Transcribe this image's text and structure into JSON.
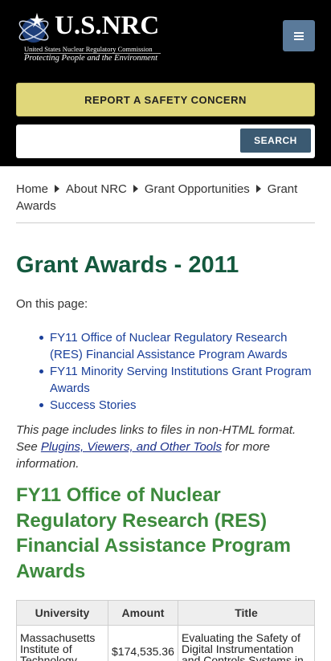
{
  "header": {
    "logo_title": "U.S.NRC",
    "logo_subtitle": "United States Nuclear Regulatory Commission",
    "logo_tagline": "Protecting People and the Environment",
    "report_label": "REPORT A SAFETY CONCERN",
    "search_placeholder": "",
    "search_label": "SEARCH"
  },
  "breadcrumb": [
    "Home",
    "About NRC",
    "Grant Opportunities",
    "Grant Awards"
  ],
  "main": {
    "title": "Grant Awards - 2011",
    "on_page_label": "On this page:",
    "toc": [
      "FY11 Office of Nuclear Regulatory Research (RES) Financial Assistance Program Awards",
      "FY11 Minority Serving Institutions Grant Program Awards",
      "Success Stories"
    ],
    "note_prefix": "This page includes links to files in non-HTML format. See ",
    "note_link": "Plugins, Viewers, and Other Tools",
    "note_suffix": " for more information.",
    "section_title": "FY11 Office of Nuclear Regulatory Research (RES) Financial Assistance Program Awards"
  },
  "table": {
    "headers": [
      "University",
      "Amount",
      "Title"
    ],
    "rows": [
      [
        "Massachusetts Institute of Technology",
        "$174,535.36",
        "Evaluating the Safety of Digital Instrumentation and Controls Systems in"
      ]
    ]
  }
}
